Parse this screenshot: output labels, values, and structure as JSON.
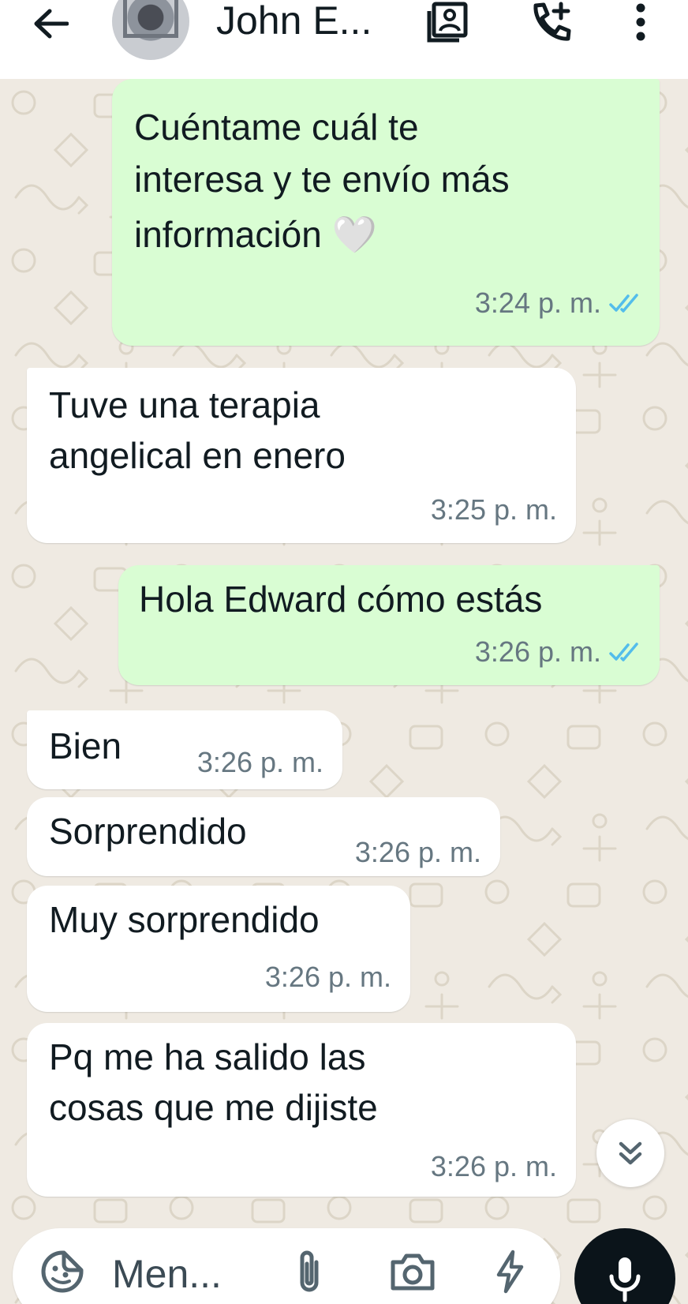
{
  "header": {
    "contact_name": "John E...",
    "icons": {
      "back": "arrow-left-icon",
      "contact_card": "contact-card-icon",
      "add_call": "add-call-icon",
      "more": "more-vertical-icon"
    }
  },
  "messages": [
    {
      "direction": "outgoing",
      "lines": [
        "Cuéntame cuál te",
        "interesa y te envío más",
        "información 🤍"
      ],
      "time": "3:24 p. m.",
      "status": "read"
    },
    {
      "direction": "incoming",
      "lines": [
        "Tuve una terapia",
        "angelical en enero"
      ],
      "time": "3:25 p. m."
    },
    {
      "direction": "outgoing",
      "lines": [
        "Hola Edward cómo estás"
      ],
      "time": "3:26 p. m.",
      "status": "read"
    },
    {
      "direction": "incoming",
      "lines": [
        "Bien"
      ],
      "time": "3:26 p. m."
    },
    {
      "direction": "incoming",
      "lines": [
        "Sorprendido"
      ],
      "time": "3:26 p. m."
    },
    {
      "direction": "incoming",
      "lines": [
        "Muy sorprendido"
      ],
      "time": "3:26 p. m."
    },
    {
      "direction": "incoming",
      "lines": [
        "Pq me ha salido las",
        "cosas que me dijiste"
      ],
      "time": "3:26 p. m."
    }
  ],
  "composer": {
    "placeholder": "Men...",
    "icons": {
      "sticker": "sticker-icon",
      "attach": "paperclip-icon",
      "camera": "camera-icon",
      "quick_reply": "lightning-icon",
      "mic": "microphone-icon"
    }
  },
  "colors": {
    "outgoing_bubble": "#d9fdd3",
    "incoming_bubble": "#ffffff",
    "read_ticks": "#53bdeb",
    "chat_background": "#efeae2",
    "mic_button": "#0b141a"
  }
}
